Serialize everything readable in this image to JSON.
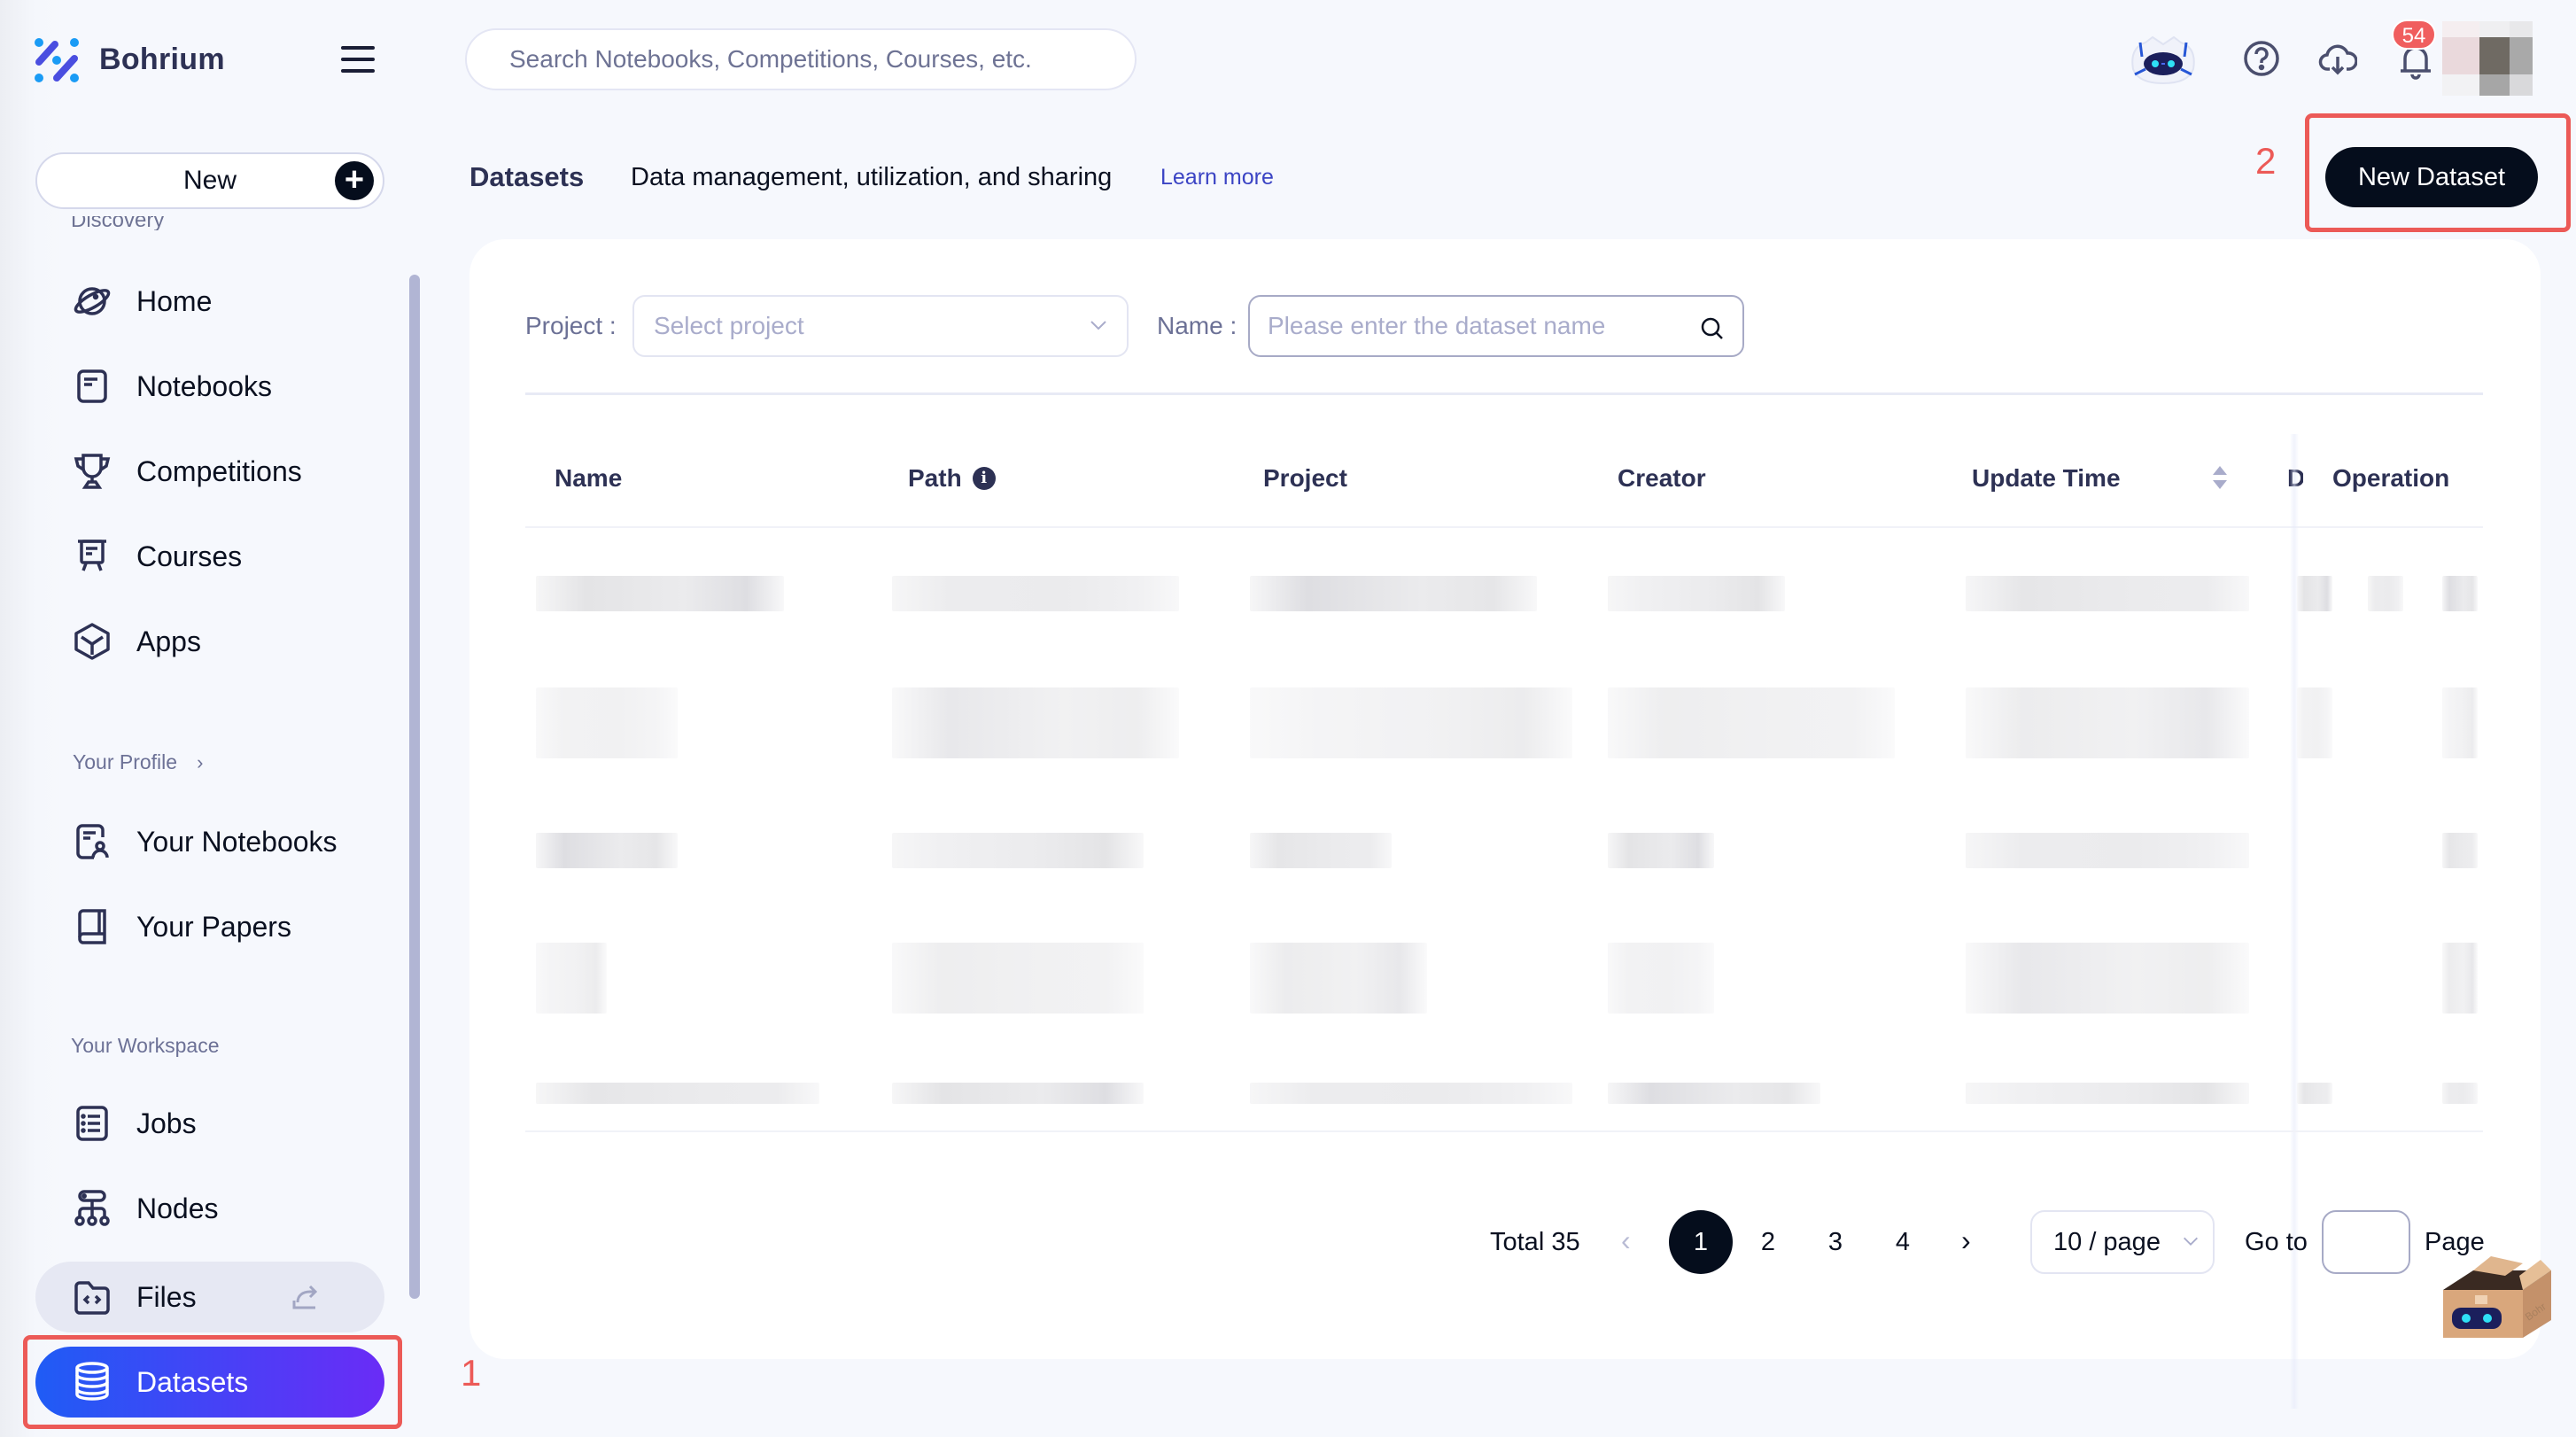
{
  "app": {
    "brand": "Bohrium",
    "logo_colors": {
      "bar": "#4a4ee0",
      "dot": "#1a9bf5"
    }
  },
  "sidebar": {
    "new_button_label": "New",
    "discovery_label": "Discovery",
    "discovery_items": [
      {
        "label": "Home",
        "icon": "planet-icon"
      },
      {
        "label": "Notebooks",
        "icon": "notebook-icon"
      },
      {
        "label": "Competitions",
        "icon": "trophy-icon"
      },
      {
        "label": "Courses",
        "icon": "presentation-board-icon"
      },
      {
        "label": "Apps",
        "icon": "cube-icon"
      }
    ],
    "profile_label": "Your Profile",
    "profile_items": [
      {
        "label": "Your Notebooks",
        "icon": "user-document-icon"
      },
      {
        "label": "Your Papers",
        "icon": "book-icon"
      }
    ],
    "workspace_label": "Your Workspace",
    "workspace_items": [
      {
        "label": "Jobs",
        "icon": "list-icon"
      },
      {
        "label": "Nodes",
        "icon": "node-tree-icon"
      },
      {
        "label": "Files",
        "icon": "code-folder-icon",
        "external": true
      },
      {
        "label": "Datasets",
        "icon": "database-icon",
        "active": true
      }
    ],
    "active_gradient": [
      "#1f5cf5",
      "#6a2cf6"
    ]
  },
  "topbar": {
    "search_placeholder": "Search Notebooks, Competitions, Courses, etc.",
    "icons": [
      "ai-assistant-robot-icon",
      "help-icon",
      "cloud-download-icon",
      "bell-icon"
    ],
    "notification_count": "54"
  },
  "page": {
    "title": "Datasets",
    "subtitle": "Data management, utilization, and sharing",
    "learn_more": "Learn more",
    "new_dataset_button": "New Dataset"
  },
  "filters": {
    "project_label": "Project",
    "project_placeholder": "Select project",
    "name_label": "Name",
    "name_placeholder": "Please enter the dataset name",
    "name_value": ""
  },
  "table": {
    "columns": [
      "Name",
      "Path",
      "Project",
      "Creator",
      "Update Time",
      "D",
      "Operation"
    ],
    "rows_redacted": true,
    "row_count_visible": 5
  },
  "pagination": {
    "total_label": "Total 35",
    "pages": [
      "1",
      "2",
      "3",
      "4"
    ],
    "current_page": "1",
    "page_size": "10 / page",
    "goto_label": "Go to",
    "goto_value": "",
    "page_label": "Page"
  },
  "annotations": [
    {
      "number": "1",
      "target": "Datasets sidebar item",
      "color": "#ec5a57"
    },
    {
      "number": "2",
      "target": "New Dataset button",
      "color": "#ec5a57"
    }
  ]
}
